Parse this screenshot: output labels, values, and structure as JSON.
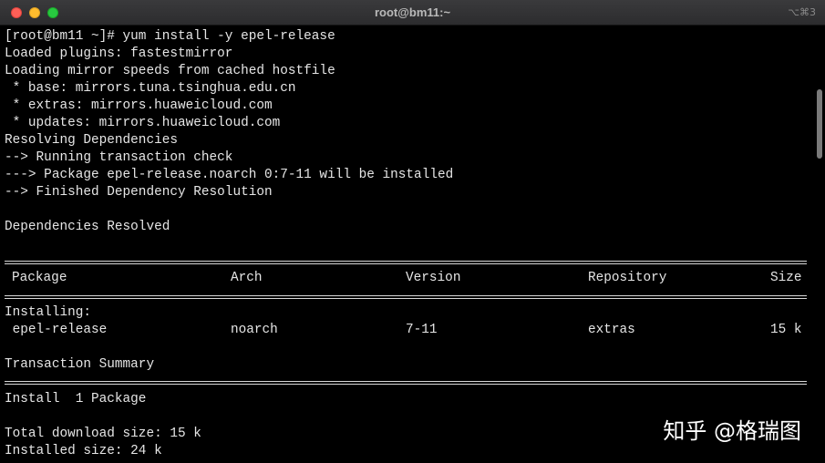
{
  "window": {
    "title": "root@bm11:~",
    "shortcut": "⌥⌘3"
  },
  "terminal": {
    "lines": [
      "[root@bm11 ~]# yum install -y epel-release",
      "Loaded plugins: fastestmirror",
      "Loading mirror speeds from cached hostfile",
      " * base: mirrors.tuna.tsinghua.edu.cn",
      " * extras: mirrors.huaweicloud.com",
      " * updates: mirrors.huaweicloud.com",
      "Resolving Dependencies",
      "--> Running transaction check",
      "---> Package epel-release.noarch 0:7-11 will be installed",
      "--> Finished Dependency Resolution",
      "Dependencies Resolved"
    ],
    "table": {
      "headers": [
        "Package",
        "Arch",
        "Version",
        "Repository",
        "Size"
      ],
      "section": "Installing:",
      "row": [
        " epel-release",
        "noarch",
        "7-11",
        "extras",
        "15 k"
      ]
    },
    "summary": {
      "title": "Transaction Summary",
      "install": "Install  1 Package",
      "download": "Total download size: 15 k",
      "installed": "Installed size: 24 k"
    }
  },
  "watermark": "知乎 @格瑞图"
}
